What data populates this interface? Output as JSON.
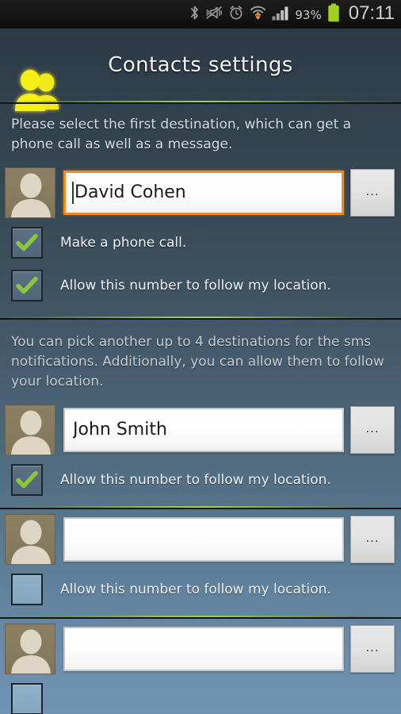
{
  "status_bar": {
    "icons": [
      "bluetooth-icon",
      "vibrate-mute-icon",
      "alarm-clock-icon",
      "wifi-download-icon",
      "signal-bars-icon"
    ],
    "battery_percent": "93%",
    "battery_color": "#9fd220",
    "clock": "07:11"
  },
  "header": {
    "title": "Contacts settings",
    "icon": "contacts-people-icon",
    "icon_color": "#f2e81e"
  },
  "colors": {
    "accent_focus": "#f08b1d",
    "divider_green": "#a0d250",
    "check_green": "#8cc63f",
    "avatar_bg": "#877b5f",
    "avatar_fg": "#ded6c4"
  },
  "section_one": {
    "info": "Please select the first destination, which can get a phone call as well as a message.",
    "contact": {
      "avatar": "contact-avatar-icon",
      "value": "David Cohen",
      "placeholder": "",
      "focused": true,
      "browse_label": "..."
    },
    "options": [
      {
        "label": "Make a phone call.",
        "checked": true
      },
      {
        "label": "Allow this number to follow my location.",
        "checked": true
      }
    ]
  },
  "section_two": {
    "info": "You can pick another up to 4 destinations for the sms notifications. Additionally, you can allow them to follow your location.",
    "contacts": [
      {
        "avatar": "contact-avatar-icon",
        "value": "John Smith",
        "placeholder": "",
        "focused": false,
        "browse_label": "...",
        "option": {
          "label": "Allow this number to follow my location.",
          "checked": true
        }
      },
      {
        "avatar": "contact-avatar-icon",
        "value": "",
        "placeholder": "",
        "focused": false,
        "browse_label": "...",
        "option": {
          "label": "Allow this number to follow my location.",
          "checked": false
        }
      },
      {
        "avatar": "contact-avatar-icon",
        "value": "",
        "placeholder": "",
        "focused": false,
        "browse_label": "...",
        "option": {
          "label": "",
          "checked": false
        }
      }
    ]
  }
}
